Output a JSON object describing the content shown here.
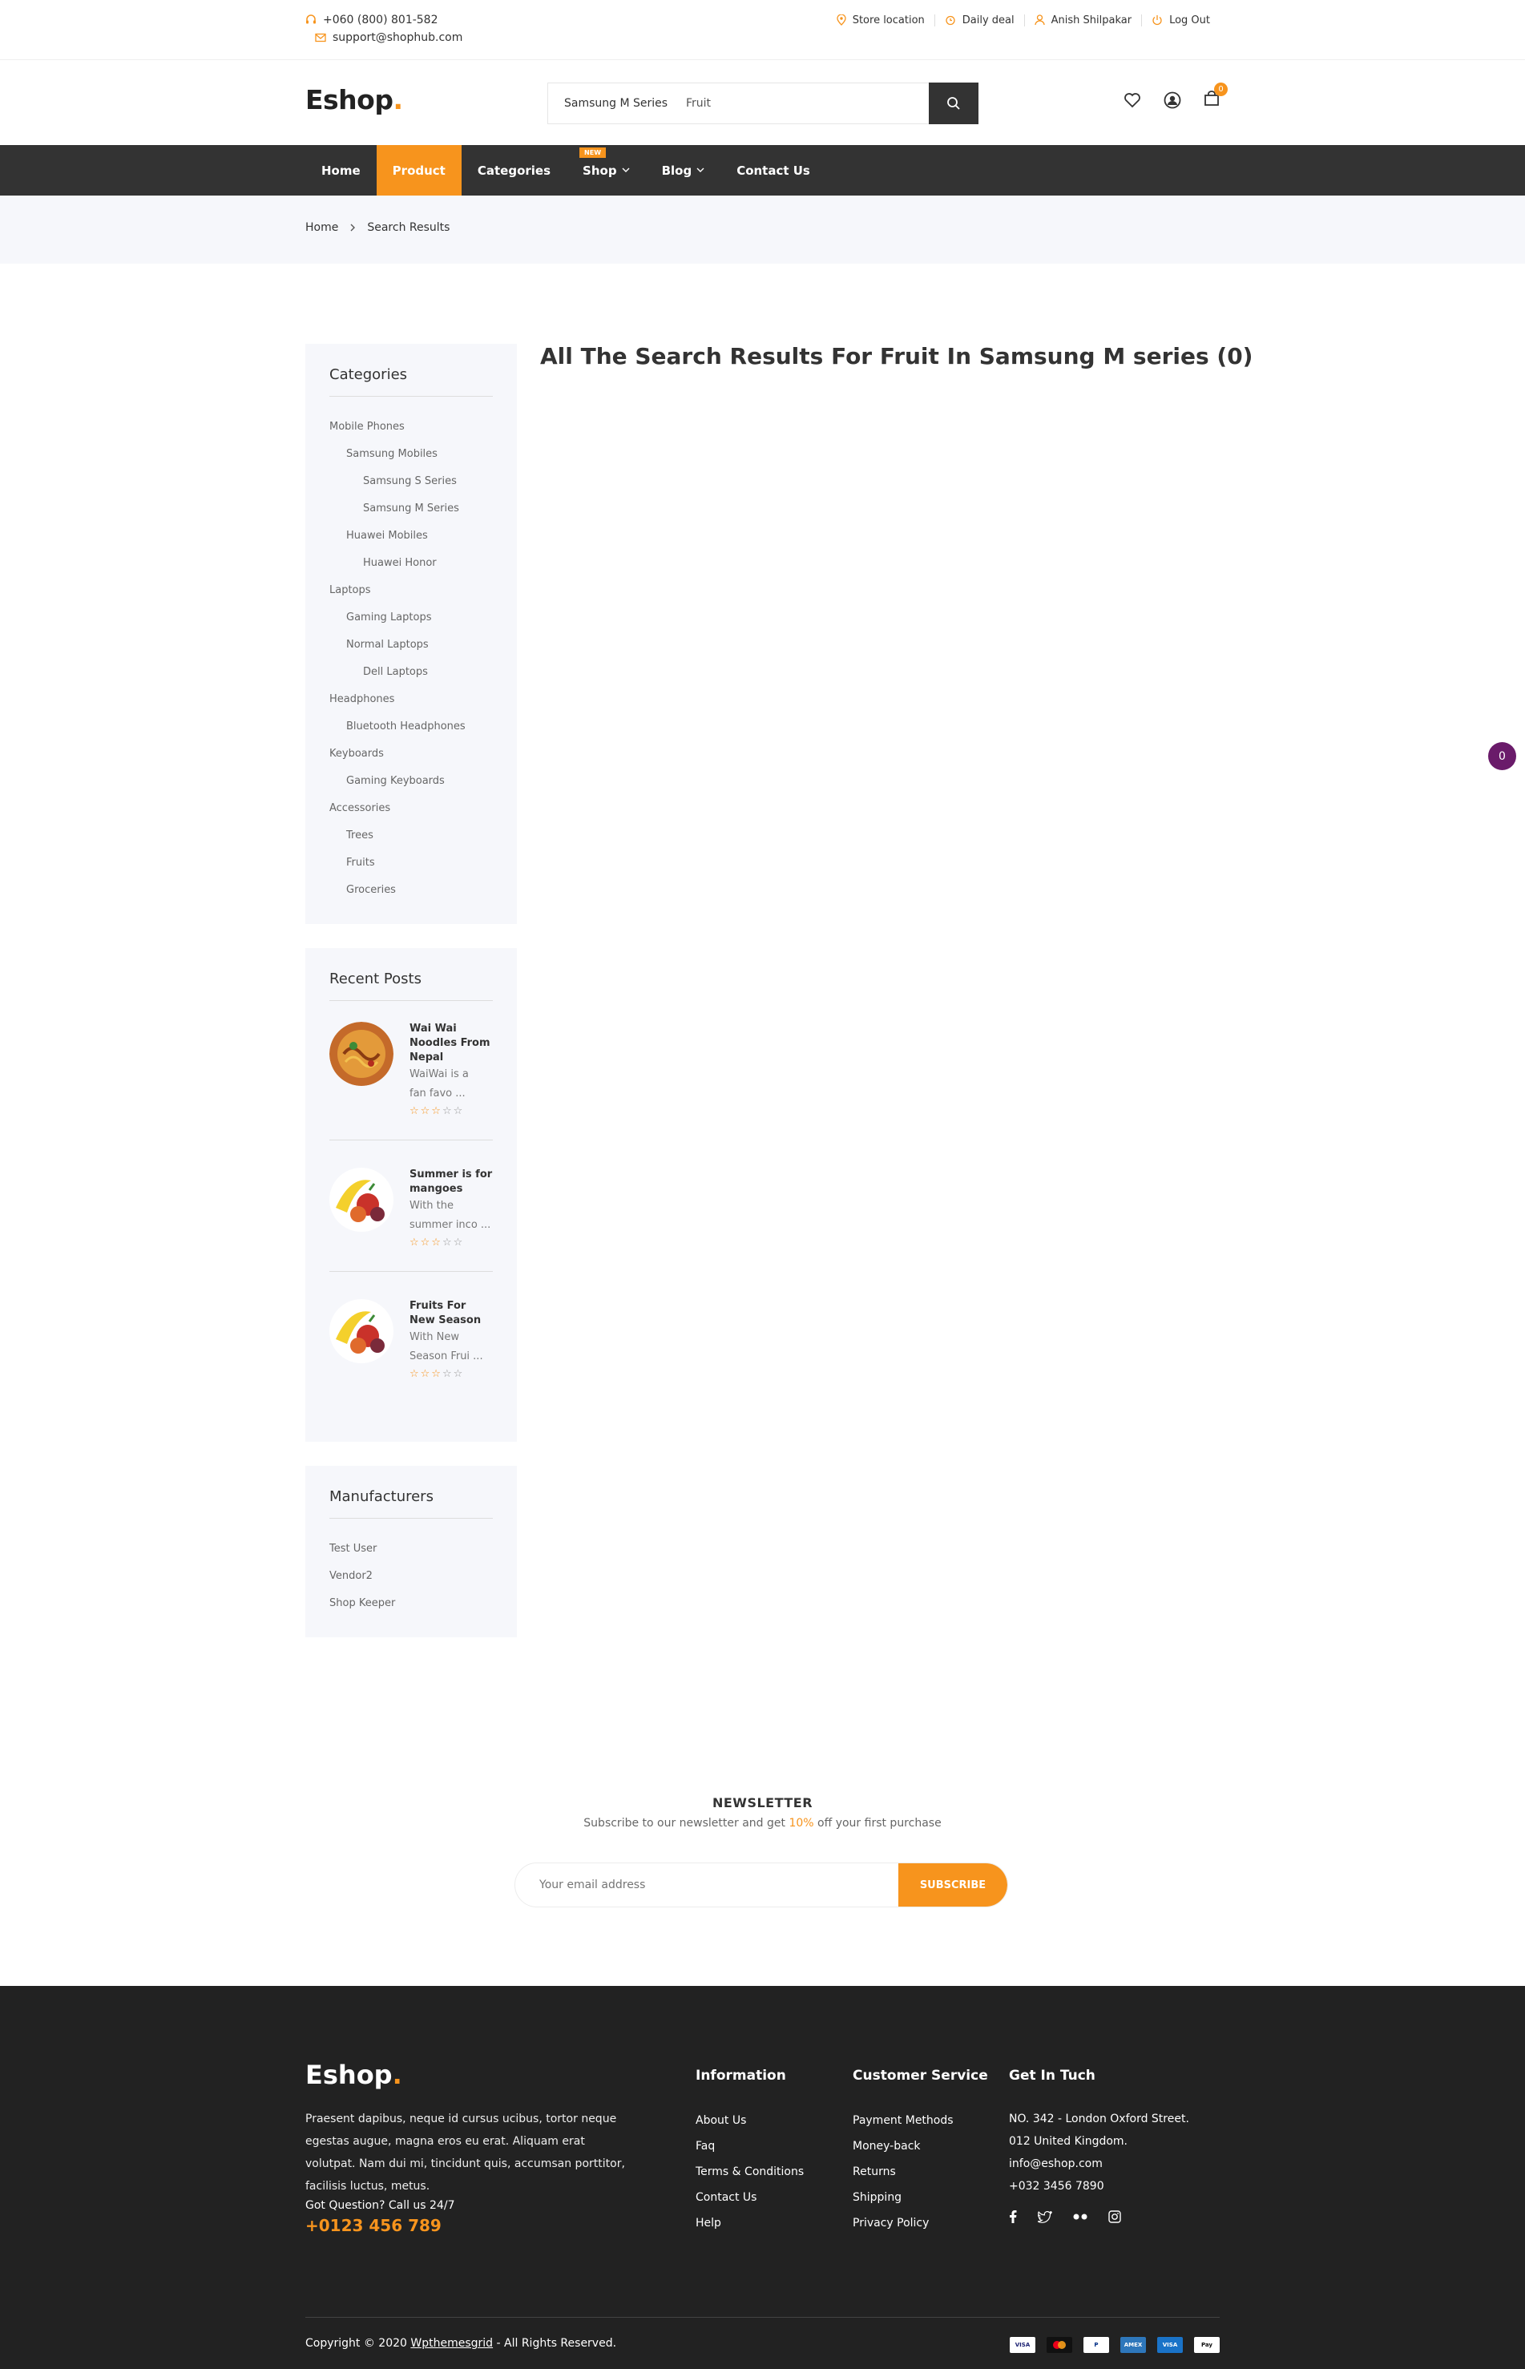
{
  "topbar": {
    "phone": "+060 (800) 801-582",
    "email": "support@shophub.com",
    "store_location": "Store location",
    "daily_deal": "Daily deal",
    "user_name": "Anish Shilpakar",
    "logout": "Log Out"
  },
  "header": {
    "logo_text": "Eshop",
    "logo_dot": ".",
    "search_category": "Samsung M Series",
    "search_value": "Fruit",
    "cart_count": "0"
  },
  "nav": {
    "items": [
      {
        "label": "Home"
      },
      {
        "label": "Product"
      },
      {
        "label": "Categories"
      },
      {
        "label": "Shop",
        "badge": "NEW"
      },
      {
        "label": "Blog"
      },
      {
        "label": "Contact Us"
      }
    ]
  },
  "breadcrumb": {
    "home": "Home",
    "current": "Search Results"
  },
  "results": {
    "title": "All The Search Results For Fruit In Samsung M series (0)"
  },
  "floating_badge": "0",
  "sidebar": {
    "categories_title": "Categories",
    "categories": [
      {
        "label": "Mobile Phones",
        "level": 1
      },
      {
        "label": "Samsung Mobiles",
        "level": 2
      },
      {
        "label": "Samsung S Series",
        "level": 3
      },
      {
        "label": "Samsung M Series",
        "level": 3
      },
      {
        "label": "Huawei Mobiles",
        "level": 2
      },
      {
        "label": "Huawei Honor",
        "level": 3
      },
      {
        "label": "Laptops",
        "level": 1
      },
      {
        "label": "Gaming Laptops",
        "level": 2
      },
      {
        "label": "Normal Laptops",
        "level": 2
      },
      {
        "label": "Dell Laptops",
        "level": 3
      },
      {
        "label": "Headphones",
        "level": 1
      },
      {
        "label": "Bluetooth Headphones",
        "level": 2
      },
      {
        "label": "Keyboards",
        "level": 1
      },
      {
        "label": "Gaming Keyboards",
        "level": 2
      },
      {
        "label": "Accessories",
        "level": 1
      },
      {
        "label": "Trees",
        "level": 2
      },
      {
        "label": "Fruits",
        "level": 2
      },
      {
        "label": "Groceries",
        "level": 2
      }
    ],
    "recent_posts_title": "Recent Posts",
    "recent_posts": [
      {
        "title": "Wai Wai Noodles From Nepal",
        "excerpt_1": "WaiWai is a",
        "excerpt_2": "fan favo ...",
        "rating": 3
      },
      {
        "title": "Summer is for mangoes",
        "excerpt_1": "With the",
        "excerpt_2": "summer inco ...",
        "rating": 3
      },
      {
        "title": "Fruits For New Season",
        "excerpt_1": "With New",
        "excerpt_2": "Season Frui ...",
        "rating": 3
      }
    ],
    "manufacturers_title": "Manufacturers",
    "manufacturers": [
      "Test User",
      "Vendor2",
      "Shop Keeper"
    ]
  },
  "newsletter": {
    "title": "NEWSLETTER",
    "text_before": "Subscribe to our newsletter and get ",
    "highlight": "10%",
    "text_after": " off your first purchase",
    "placeholder": "Your email address",
    "button": "SUBSCRIBE"
  },
  "footer": {
    "logo_text": "Eshop",
    "logo_dot": ".",
    "about": "Praesent dapibus, neque id cursus ucibus, tortor neque egestas augue, magna eros eu erat. Aliquam erat volutpat. Nam dui mi, tincidunt quis, accumsan porttitor, facilisis luctus, metus.",
    "question": "Got Question? Call us 24/7",
    "phone": "+0123 456 789",
    "information_title": "Information",
    "information": [
      "About Us",
      "Faq",
      "Terms & Conditions",
      "Contact Us",
      "Help"
    ],
    "service_title": "Customer Service",
    "service": [
      "Payment Methods",
      "Money-back",
      "Returns",
      "Shipping",
      "Privacy Policy"
    ],
    "contact_title": "Get In Tuch",
    "address_1": "NO. 342 - London Oxford Street.",
    "address_2": "012 United Kingdom.",
    "contact_email": "info@eshop.com",
    "contact_phone": "+032 3456 7890",
    "copyright_prefix": "Copyright © 2020 ",
    "copyright_link": "Wpthemesgrid",
    "copyright_suffix": " - All Rights Reserved.",
    "payment_icons": [
      "visa",
      "mastercard",
      "paypal",
      "american-express",
      "visa-blue",
      "apple-pay"
    ]
  },
  "colors": {
    "accent": "#f7941d",
    "nav_bg": "#333333",
    "footer_bg": "#222222",
    "sidebar_bg": "#f6f7fb",
    "badge_purple": "#6a1b6a"
  }
}
